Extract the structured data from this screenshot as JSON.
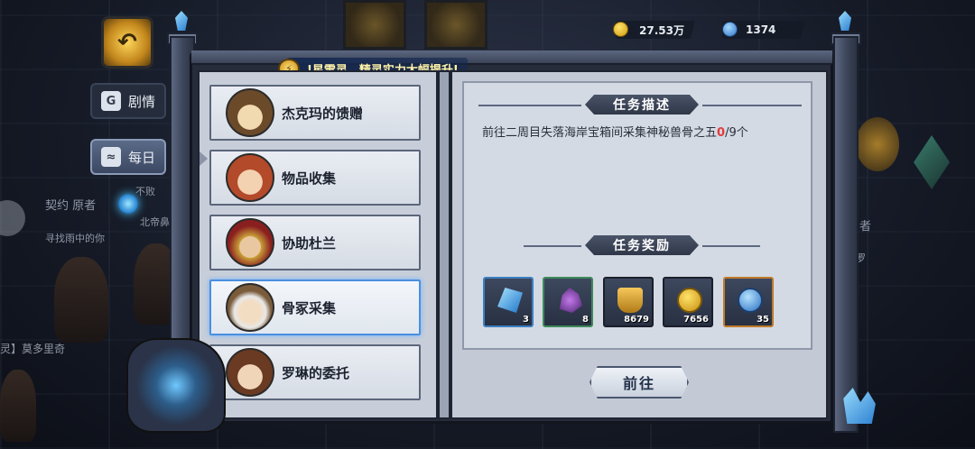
{
  "hud": {
    "gold": "27.53万",
    "gems": "1374"
  },
  "side_nav": {
    "story_label": "剧情",
    "daily_label": "每日"
  },
  "background_text": {
    "t1": "契约 原者",
    "t2": "不败",
    "t3": "北帝鼻",
    "t4": "寻找雨中的你",
    "t5": "灵】莫多里奇",
    "t6": "者",
    "t7": "罗"
  },
  "banner": {
    "text": "!星雷灵，精灵实力大幅提升!"
  },
  "tasks": [
    {
      "label": "杰克玛的馈赠",
      "avatar": "hat-man-icon"
    },
    {
      "label": "物品收集",
      "avatar": "feather-woman-icon"
    },
    {
      "label": "协助杜兰",
      "avatar": "knight-icon"
    },
    {
      "label": "骨冢采集",
      "avatar": "old-man-icon",
      "active": true
    },
    {
      "label": "罗琳的委托",
      "avatar": "girl-icon"
    }
  ],
  "detail": {
    "desc_header": "任务描述",
    "desc_prefix": "前往二周目失落海岸宝箱间采集神秘兽骨之五",
    "desc_current": "0",
    "desc_suffix": "/9个",
    "reward_header": "任务奖励",
    "go_label": "前往"
  },
  "rewards": [
    {
      "icon": "blue-crystal-icon",
      "count": "3"
    },
    {
      "icon": "purple-ore-icon",
      "count": "8"
    },
    {
      "icon": "badge-icon",
      "count": "8679"
    },
    {
      "icon": "gold-coin-icon",
      "count": "7656"
    },
    {
      "icon": "blue-orb-icon",
      "count": "35"
    }
  ],
  "colors": {
    "accent_blue": "#4a8fe0",
    "highlight_red": "#e23b3b",
    "banner_text": "#fff3a8"
  }
}
